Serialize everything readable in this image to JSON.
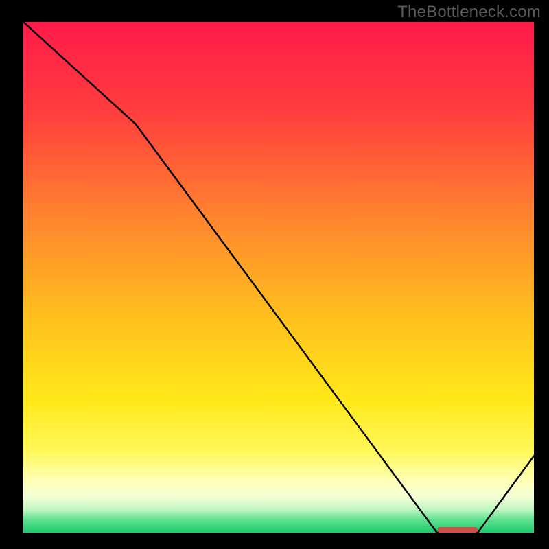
{
  "watermark": "TheBottleneck.com",
  "chart_data": {
    "type": "line",
    "title": "",
    "xlabel": "",
    "ylabel": "",
    "xlim": [
      0,
      100
    ],
    "ylim": [
      0,
      100
    ],
    "x": [
      0,
      22,
      81,
      89,
      100
    ],
    "values": [
      100,
      80,
      0,
      0,
      15
    ],
    "optimum_range": [
      81,
      89
    ],
    "gradient_stops": [
      {
        "offset": 0,
        "color": "#ff1a4a"
      },
      {
        "offset": 18,
        "color": "#ff3f3d"
      },
      {
        "offset": 40,
        "color": "#ff8a2d"
      },
      {
        "offset": 58,
        "color": "#ffc01e"
      },
      {
        "offset": 74,
        "color": "#ffe81a"
      },
      {
        "offset": 84,
        "color": "#fff85a"
      },
      {
        "offset": 90,
        "color": "#ffffba"
      },
      {
        "offset": 93,
        "color": "#f3ffd6"
      },
      {
        "offset": 95.5,
        "color": "#bdf7c1"
      },
      {
        "offset": 97.5,
        "color": "#5de28e"
      },
      {
        "offset": 100,
        "color": "#1fc96f"
      }
    ],
    "curve_color": "#000000",
    "marker_color": "#c6524a"
  }
}
